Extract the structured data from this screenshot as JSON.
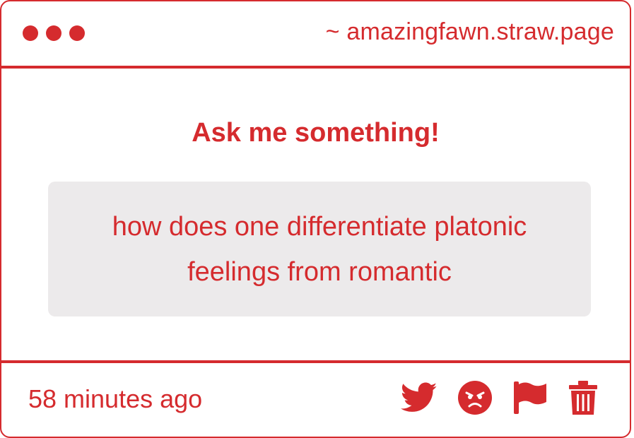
{
  "window": {
    "url": "~ amazingfawn.straw.page",
    "accent_color": "#d52b2e"
  },
  "content": {
    "heading": "Ask me something!",
    "question": "how does one differentiate platonic feelings from romantic"
  },
  "footer": {
    "timestamp": "58 minutes ago",
    "actions": [
      {
        "icon": "twitter-icon"
      },
      {
        "icon": "angry-face-icon"
      },
      {
        "icon": "flag-icon"
      },
      {
        "icon": "trash-icon"
      }
    ]
  }
}
